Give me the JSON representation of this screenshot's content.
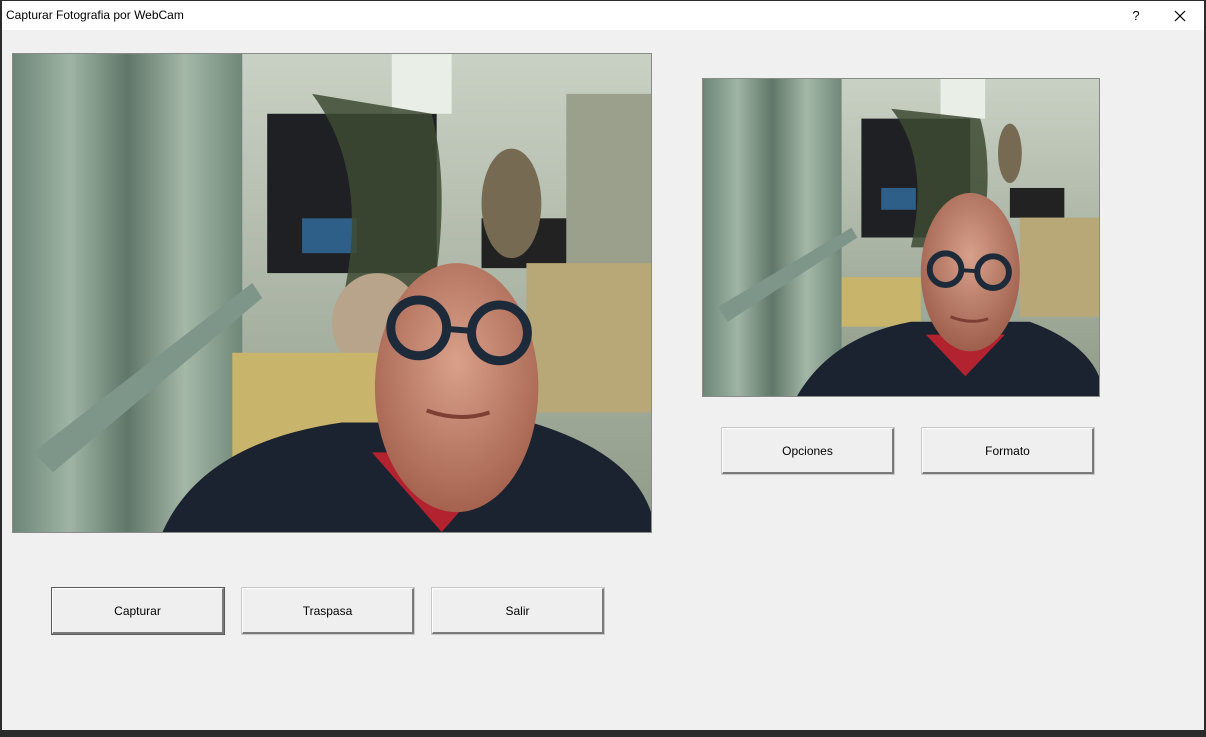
{
  "window": {
    "title": "Capturar Fotografia por WebCam",
    "help_label": "?",
    "close_icon": "close-icon"
  },
  "preview": {
    "main_image": "webcam-live-preview",
    "captured_image": "captured-photo-thumbnail"
  },
  "buttons": {
    "capturar": "Capturar",
    "traspasa": "Traspasa",
    "salir": "Salir",
    "opciones": "Opciones",
    "formato": "Formato"
  },
  "colors": {
    "window_bg": "#f0f0f0",
    "titlebar_bg": "#ffffff",
    "frame_border": "#8a8a8a"
  }
}
